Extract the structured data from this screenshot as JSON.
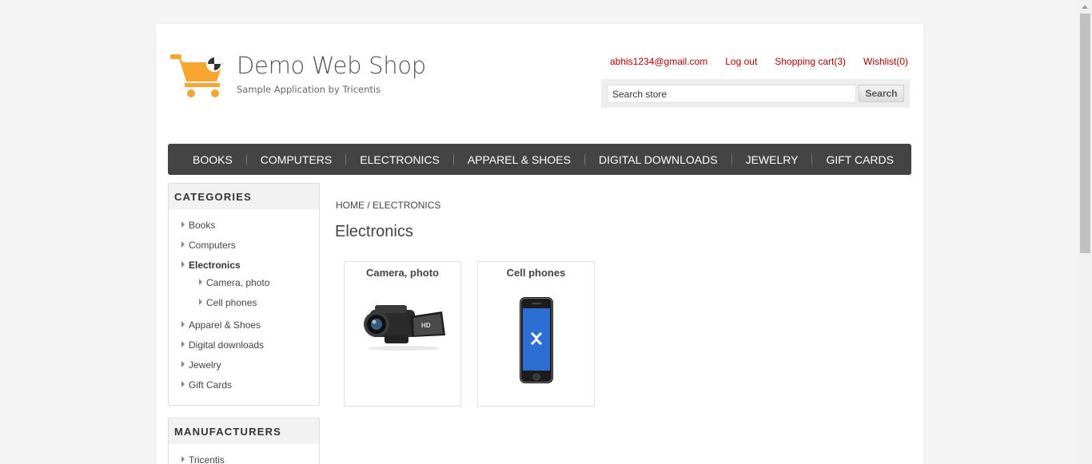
{
  "header": {
    "store_name": "Demo Web Shop",
    "store_subtitle": "Sample Application by Tricentis",
    "links": {
      "account": "abhis1234@gmail.com",
      "logout": "Log out",
      "cart": "Shopping cart(3)",
      "wishlist": "Wishlist(0)"
    },
    "search": {
      "value": "Search store",
      "button": "Search"
    }
  },
  "top_menu": [
    "BOOKS",
    "COMPUTERS",
    "ELECTRONICS",
    "APPAREL & SHOES",
    "DIGITAL DOWNLOADS",
    "JEWELRY",
    "GIFT CARDS"
  ],
  "sidebar": {
    "categories_title": "CATEGORIES",
    "categories": [
      {
        "label": "Books"
      },
      {
        "label": "Computers"
      },
      {
        "label": "Electronics"
      },
      {
        "label": "Camera, photo"
      },
      {
        "label": "Cell phones"
      },
      {
        "label": "Apparel & Shoes"
      },
      {
        "label": "Digital downloads"
      },
      {
        "label": "Jewelry"
      },
      {
        "label": "Gift Cards"
      }
    ],
    "manufacturers_title": "MANUFACTURERS",
    "manufacturers": [
      "Tricentis"
    ]
  },
  "main": {
    "breadcrumb": {
      "home": "HOME",
      "separator": " / ",
      "current": "ELECTRONICS"
    },
    "heading": "Electronics",
    "subcategories": [
      {
        "label": "Camera, photo",
        "image": "camcorder"
      },
      {
        "label": "Cell phones",
        "image": "smartphone"
      }
    ]
  },
  "colors": {
    "link": "#aa0000",
    "menu_bg": "#444444",
    "logo": "#f8a532"
  }
}
